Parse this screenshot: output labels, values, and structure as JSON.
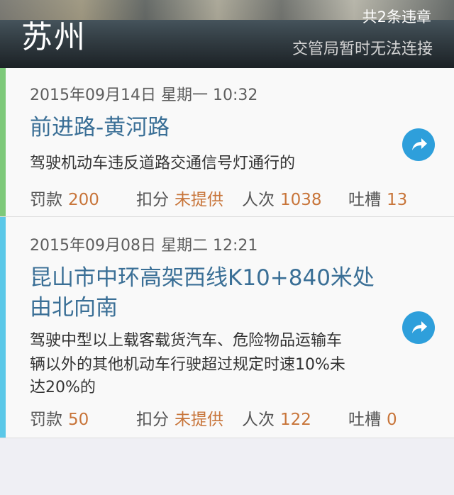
{
  "header": {
    "city": "苏州",
    "violation_count": "共2条违章",
    "status": "交管局暂时无法连接"
  },
  "violations": [
    {
      "datetime": "2015年09月14日 星期一 10:32",
      "location": "前进路-黄河路",
      "description": "驾驶机动车违反道路交通信号灯通行的",
      "fine_label": "罚款",
      "fine_value": "200",
      "points_label": "扣分",
      "points_value": "未提供",
      "visits_label": "人次",
      "visits_value": "1038",
      "comments_label": "吐槽",
      "comments_value": "13",
      "accent_color": "#7dc97a"
    },
    {
      "datetime": "2015年09月08日 星期二 12:21",
      "location_line1": "昆山市中环高架西线K10+840米处",
      "location_line2": "由北向南",
      "description_line1": "驾驶中型以上载客载货汽车、危险物品运输车",
      "description_line2": "辆以外的其他机动车行驶超过规定时速10%未",
      "description_line3": "达20%的",
      "fine_label": "罚款",
      "fine_value": "50",
      "points_label": "扣分",
      "points_value": "未提供",
      "visits_label": "人次",
      "visits_value": "122",
      "comments_label": "吐槽",
      "comments_value": "0",
      "accent_color": "#5bc8e8"
    }
  ],
  "icons": {
    "share": "share-arrow-icon"
  },
  "colors": {
    "link": "#3a6f96",
    "value": "#c8753a",
    "share_bg": "#2e9fdb"
  }
}
